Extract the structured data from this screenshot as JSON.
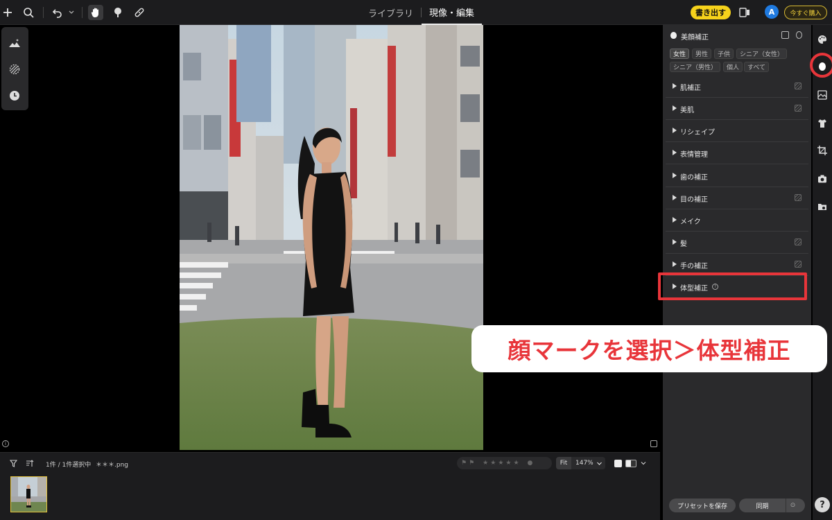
{
  "toolbar": {
    "center_tabs": [
      "ライブラリ",
      "現像・編集"
    ],
    "active_tab": "現像・編集",
    "export_label": "書き出す",
    "avatar_letter": "A",
    "buy_label": "今すぐ購入"
  },
  "edit_panel": {
    "title": "美顔補正",
    "chips": [
      "女性",
      "男性",
      "子供",
      "シニア（女性）",
      "シニア（男性）",
      "個人",
      "すべて"
    ],
    "active_chip": "女性",
    "sections": [
      {
        "label": "肌補正",
        "editable": true
      },
      {
        "label": "美肌",
        "editable": true
      },
      {
        "label": "リシェイプ",
        "editable": false
      },
      {
        "label": "表情管理",
        "editable": false
      },
      {
        "label": "歯の補正",
        "editable": false
      },
      {
        "label": "目の補正",
        "editable": true
      },
      {
        "label": "メイク",
        "editable": false
      },
      {
        "label": "髪",
        "editable": true
      },
      {
        "label": "手の補正",
        "editable": true
      },
      {
        "label": "体型補正",
        "editable": false
      }
    ],
    "save_preset_label": "プリセットを保存",
    "sync_label": "同期"
  },
  "filmstrip": {
    "selection_text": "1件 / 1件選択中",
    "filename": "＊＊＊.png",
    "fit_label": "Fit",
    "zoom": "147%"
  },
  "annotation": {
    "text": "顔マークを選択＞体型補正"
  },
  "colors": {
    "accent_yellow": "#f6d21b",
    "annotation_red": "#e8353a"
  }
}
